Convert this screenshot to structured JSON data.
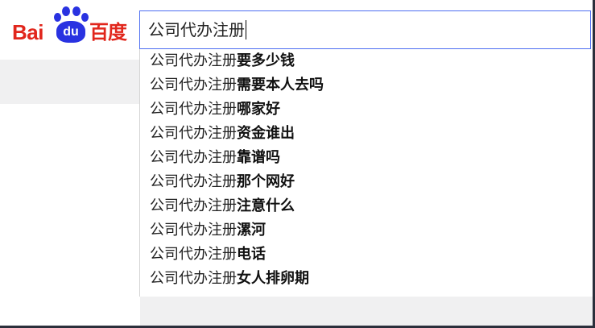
{
  "logo": {
    "bai_text": "Bai",
    "du_text": "du",
    "cn_text": "百度",
    "brand_red": "#e1261c",
    "brand_blue": "#2932e1",
    "icon": "baidu-paw-icon"
  },
  "search": {
    "value": "公司代办注册",
    "accent": "#4e6ef2"
  },
  "suggestions": [
    {
      "prefix": "公司代办注册",
      "rest": "要多少钱"
    },
    {
      "prefix": "公司代办注册",
      "rest": "需要本人去吗"
    },
    {
      "prefix": "公司代办注册",
      "rest": "哪家好"
    },
    {
      "prefix": "公司代办注册",
      "rest": "资金谁出"
    },
    {
      "prefix": "公司代办注册",
      "rest": "靠谱吗"
    },
    {
      "prefix": "公司代办注册",
      "rest": "那个网好"
    },
    {
      "prefix": "公司代办注册",
      "rest": "注意什么"
    },
    {
      "prefix": "公司代办注册",
      "rest": "漯河"
    },
    {
      "prefix": "公司代办注册",
      "rest": "电话"
    },
    {
      "prefix": "公司代办注册",
      "rest": "女人排卵期"
    }
  ]
}
